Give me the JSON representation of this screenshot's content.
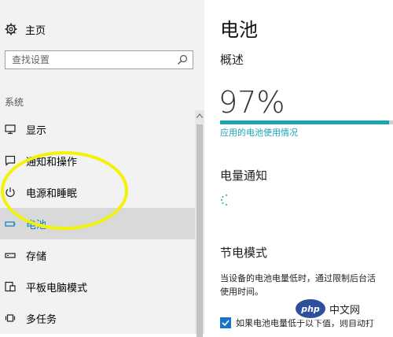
{
  "sidebar": {
    "home": {
      "label": "主页",
      "icon": "gear-icon"
    },
    "search": {
      "placeholder": "查找设置",
      "icon": "search-icon"
    },
    "section_title": "系统",
    "items": [
      {
        "label": "显示",
        "icon": "monitor-icon",
        "active": false
      },
      {
        "label": "通知和操作",
        "icon": "notification-icon",
        "active": false
      },
      {
        "label": "电源和睡眠",
        "icon": "power-icon",
        "active": false
      },
      {
        "label": "电池",
        "icon": "battery-icon",
        "active": true
      },
      {
        "label": "存储",
        "icon": "storage-icon",
        "active": false
      },
      {
        "label": "平板电脑模式",
        "icon": "tablet-mode-icon",
        "active": false
      },
      {
        "label": "多任务",
        "icon": "multitask-icon",
        "active": false
      }
    ]
  },
  "main": {
    "title": "电池",
    "overview": {
      "heading": "概述",
      "percent_text": "97%",
      "percent_value": 97,
      "usage_link": "应用的电池使用情况"
    },
    "notifications": {
      "heading": "电量通知"
    },
    "saver": {
      "heading": "节电模式",
      "description_line1": "当设备的电池电量低时，通过限制后台活",
      "description_line2": "使用时间。",
      "checkbox_label": "如果电池电量低于以下值，则自动打",
      "checkbox_checked": true
    }
  },
  "watermark": {
    "logo_text": "php",
    "text": "中文网"
  },
  "colors": {
    "accent": "#1aa6b7",
    "active_nav_text": "#0a7fbf",
    "highlight_circle": "#f2f20a",
    "checkbox": "#1a73c7"
  }
}
